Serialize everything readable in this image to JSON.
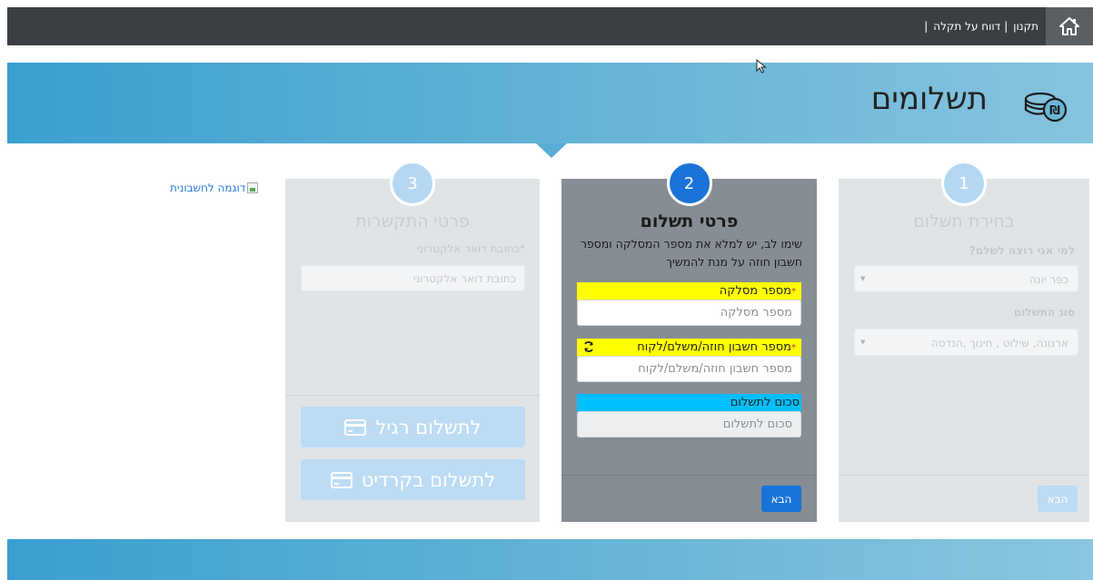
{
  "topbar": {
    "home_icon": "home-icon",
    "links": [
      "תקנון",
      "דווח על תקלה"
    ],
    "separator": "|"
  },
  "hero": {
    "title": "תשלומים",
    "icon": "coins-icon",
    "colors": {
      "start": "#3a9fd0",
      "end": "#86c4de"
    }
  },
  "steps": [
    {
      "number": "1",
      "title": "בחירת תשלום",
      "fields": [
        {
          "label": "למי אני רוצה לשלם?",
          "value": "כפר יונה"
        },
        {
          "label": "סוג התשלום",
          "value": "ארנונה, שילוט , חינוך ,הנדסה"
        }
      ],
      "next_label": "הבא"
    },
    {
      "number": "2",
      "title": "פרטי תשלום",
      "hint": "שימו לב, יש למלא את מספר המסלקה ומספר חשבון חוזה על מנת להמשיך",
      "fields": [
        {
          "label": "מספר מסלקה",
          "required": "*",
          "placeholder": "מספר מסלקה"
        },
        {
          "label": "מספר חשבון חוזה/משלם/לקוח",
          "required": "*",
          "placeholder": "מספר חשבון חוזה/משלם/לקוח"
        },
        {
          "label": "סכום לתשלום",
          "placeholder": "סכום לתשלום"
        }
      ],
      "next_label": "הבא",
      "accent": "#1a73d8"
    },
    {
      "number": "3",
      "title": "פרטי התקשרות",
      "email_label": "כתובת דואר אלקטרוני",
      "email_required": "*",
      "email_placeholder": "כתובת דואר אלקטרוני",
      "regular_pay_label": "לתשלום רגיל",
      "credit_pay_label": "לתשלום בקרדיט"
    }
  ],
  "invoice_link": "דוגמה לחשבונית",
  "colors": {
    "highlight_yellow": "#ffff00",
    "highlight_cyan": "#00bfff",
    "topbar": "#3a3f44"
  }
}
